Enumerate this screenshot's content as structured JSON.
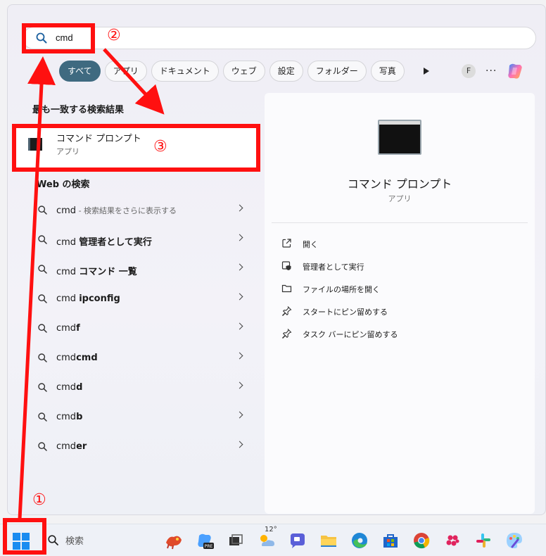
{
  "search": {
    "query": "cmd"
  },
  "filters": [
    "すべて",
    "アプリ",
    "ドキュメント",
    "ウェブ",
    "設定",
    "フォルダー",
    "写真"
  ],
  "filters_extra": {
    "avatar_letter": "F",
    "more": "···"
  },
  "best_match": {
    "section_title": "最も一致する検索結果",
    "name": "コマンド プロンプト",
    "type": "アプリ"
  },
  "web": {
    "section_title": "Web の検索",
    "items": [
      {
        "prefix": "cmd",
        "bold": "",
        "hint": " - 検索結果をさらに表示する"
      },
      {
        "prefix": "cmd ",
        "bold": "管理者として実行",
        "hint": ""
      },
      {
        "prefix": "cmd ",
        "bold": "コマンド 一覧",
        "hint": ""
      },
      {
        "prefix": "cmd ",
        "bold": "ipconfig",
        "hint": ""
      },
      {
        "prefix": "cmd",
        "bold": "f",
        "hint": ""
      },
      {
        "prefix": "cmd",
        "bold": "cmd",
        "hint": ""
      },
      {
        "prefix": "cmd",
        "bold": "d",
        "hint": ""
      },
      {
        "prefix": "cmd",
        "bold": "b",
        "hint": ""
      },
      {
        "prefix": "cmd",
        "bold": "er",
        "hint": ""
      }
    ]
  },
  "details": {
    "name": "コマンド プロンプト",
    "type": "アプリ",
    "actions": [
      "開く",
      "管理者として実行",
      "ファイルの場所を開く",
      "スタートにピン留めする",
      "タスク バーにピン留めする"
    ]
  },
  "taskbar": {
    "search_placeholder": "検索",
    "weather_temp": "12°"
  },
  "annotations": {
    "one": "①",
    "two": "②",
    "three": "③"
  },
  "colors": {
    "accent": "#3f6a80",
    "annotation": "#ff1010"
  }
}
